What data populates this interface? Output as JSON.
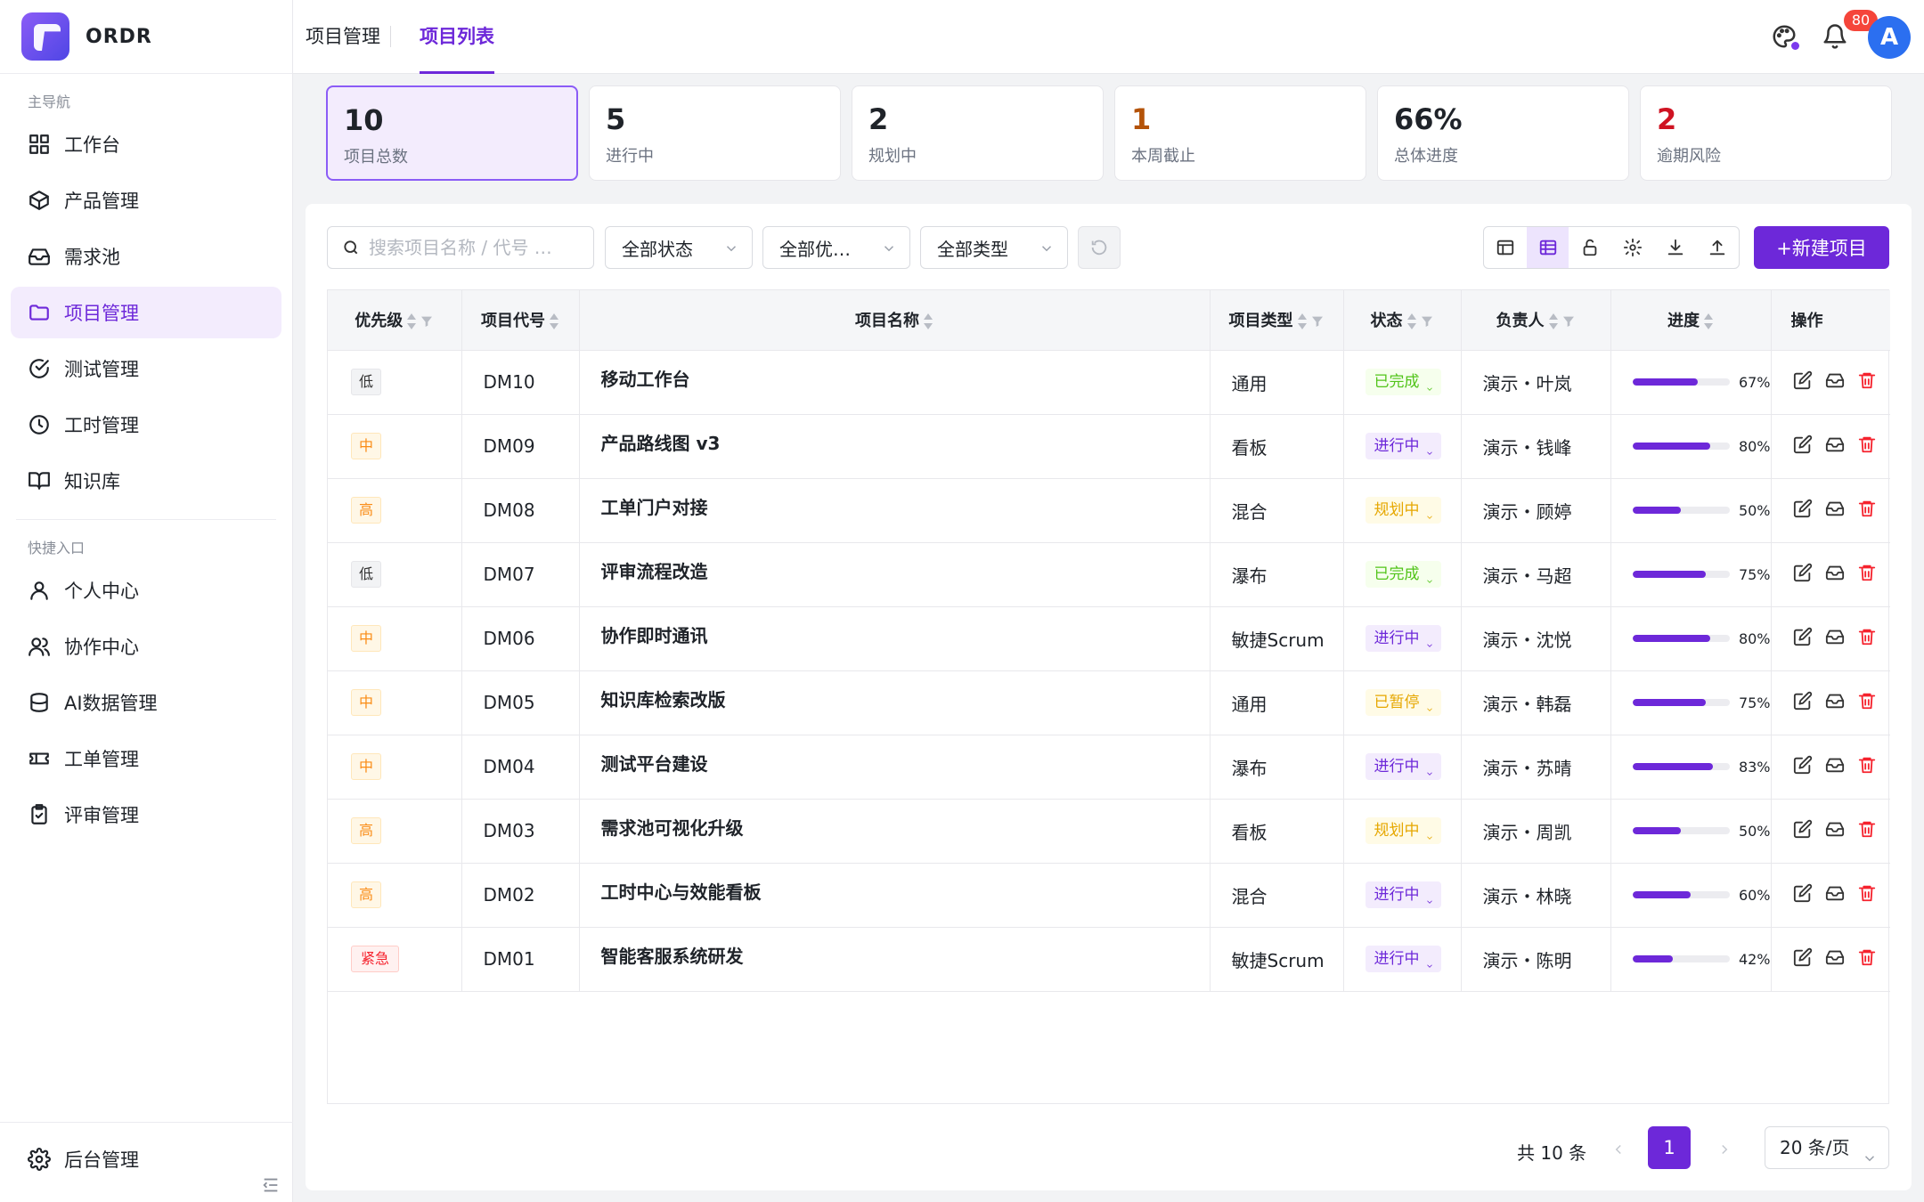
{
  "app": {
    "name": "ORDR"
  },
  "sidebar": {
    "group1_label": "主导航",
    "group1_items": [
      {
        "label": "工作台",
        "icon": "grid-icon"
      },
      {
        "label": "产品管理",
        "icon": "box-icon"
      },
      {
        "label": "需求池",
        "icon": "inbox-icon"
      },
      {
        "label": "项目管理",
        "icon": "folder-icon",
        "active": true
      },
      {
        "label": "测试管理",
        "icon": "check-circle-icon"
      },
      {
        "label": "工时管理",
        "icon": "clock-icon"
      },
      {
        "label": "知识库",
        "icon": "book-icon"
      }
    ],
    "group2_label": "快捷入口",
    "group2_items": [
      {
        "label": "个人中心",
        "icon": "user-icon"
      },
      {
        "label": "协作中心",
        "icon": "users-icon"
      },
      {
        "label": "AI数据管理",
        "icon": "database-icon"
      },
      {
        "label": "工单管理",
        "icon": "ticket-icon"
      },
      {
        "label": "评审管理",
        "icon": "clipboard-check-icon"
      }
    ],
    "bottom_item": {
      "label": "后台管理",
      "icon": "gear-icon"
    }
  },
  "header": {
    "breadcrumb_1": "项目管理",
    "breadcrumb_2": "项目列表",
    "notification_count": "80",
    "avatar_letter": "A"
  },
  "stats": [
    {
      "value": "10",
      "label": "项目总数",
      "color": "#1f2329"
    },
    {
      "value": "5",
      "label": "进行中",
      "color": "#1f2329"
    },
    {
      "value": "2",
      "label": "规划中",
      "color": "#1f2329"
    },
    {
      "value": "1",
      "label": "本周截止",
      "color": "#b45309"
    },
    {
      "value": "66%",
      "label": "总体进度",
      "color": "#1f2329"
    },
    {
      "value": "2",
      "label": "逾期风险",
      "color": "#cf1322"
    }
  ],
  "filters": {
    "search_placeholder": "搜索项目名称 / 代号 …",
    "status": "全部状态",
    "priority": "全部优…",
    "type": "全部类型"
  },
  "toolbar": {
    "new_button": "+新建项目"
  },
  "table": {
    "headers": [
      "优先级",
      "项目代号",
      "项目名称",
      "项目类型",
      "状态",
      "负责人",
      "进度",
      "操作"
    ],
    "rows": [
      {
        "priority": "低",
        "pri_cls": "low",
        "code": "DM10",
        "name": "移动工作台",
        "type": "通用",
        "status": "已完成",
        "st_cls": "done",
        "owner": "演示・叶岚",
        "progress": 67,
        "progress_label": "67%"
      },
      {
        "priority": "中",
        "pri_cls": "mid",
        "code": "DM09",
        "name": "产品路线图 v3",
        "type": "看板",
        "status": "进行中",
        "st_cls": "doing",
        "owner": "演示・钱峰",
        "progress": 80,
        "progress_label": "80%"
      },
      {
        "priority": "高",
        "pri_cls": "high",
        "code": "DM08",
        "name": "工单门户对接",
        "type": "混合",
        "status": "规划中",
        "st_cls": "plan",
        "owner": "演示・顾婷",
        "progress": 50,
        "progress_label": "50%"
      },
      {
        "priority": "低",
        "pri_cls": "low",
        "code": "DM07",
        "name": "评审流程改造",
        "type": "瀑布",
        "status": "已完成",
        "st_cls": "done",
        "owner": "演示・马超",
        "progress": 75,
        "progress_label": "75%"
      },
      {
        "priority": "中",
        "pri_cls": "mid",
        "code": "DM06",
        "name": "协作即时通讯",
        "type": "敏捷Scrum",
        "status": "进行中",
        "st_cls": "doing",
        "owner": "演示・沈悦",
        "progress": 80,
        "progress_label": "80%"
      },
      {
        "priority": "中",
        "pri_cls": "mid",
        "code": "DM05",
        "name": "知识库检索改版",
        "type": "通用",
        "status": "已暂停",
        "st_cls": "pause",
        "owner": "演示・韩磊",
        "progress": 75,
        "progress_label": "75%"
      },
      {
        "priority": "中",
        "pri_cls": "mid",
        "code": "DM04",
        "name": "测试平台建设",
        "type": "瀑布",
        "status": "进行中",
        "st_cls": "doing",
        "owner": "演示・苏晴",
        "progress": 83,
        "progress_label": "83%"
      },
      {
        "priority": "高",
        "pri_cls": "high",
        "code": "DM03",
        "name": "需求池可视化升级",
        "type": "看板",
        "status": "规划中",
        "st_cls": "plan",
        "owner": "演示・周凯",
        "progress": 50,
        "progress_label": "50%"
      },
      {
        "priority": "高",
        "pri_cls": "high",
        "code": "DM02",
        "name": "工时中心与效能看板",
        "type": "混合",
        "status": "进行中",
        "st_cls": "doing",
        "owner": "演示・林晓",
        "progress": 60,
        "progress_label": "60%"
      },
      {
        "priority": "紧急",
        "pri_cls": "urgent",
        "code": "DM01",
        "name": "智能客服系统研发",
        "type": "敏捷Scrum",
        "status": "进行中",
        "st_cls": "doing",
        "owner": "演示・陈明",
        "progress": 42,
        "progress_label": "42%"
      }
    ]
  },
  "pagination": {
    "total": "共 10 条",
    "current": "1",
    "page_size": "20 条/页"
  }
}
